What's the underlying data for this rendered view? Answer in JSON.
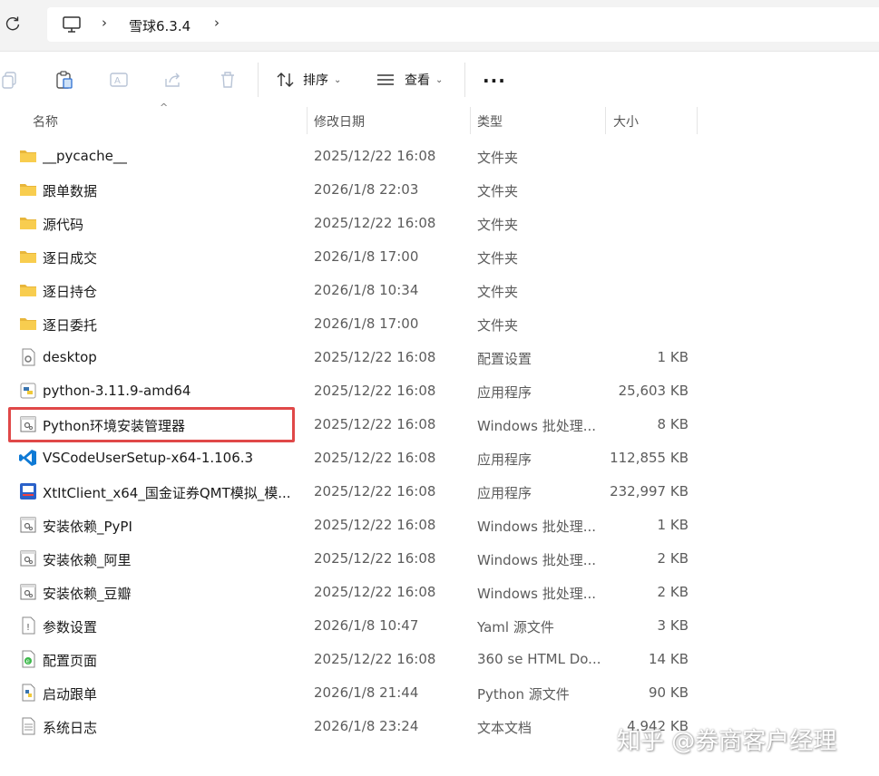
{
  "breadcrumb": {
    "current": "雪球6.3.4"
  },
  "toolbar": {
    "sort_label": "排序",
    "view_label": "查看",
    "more_label": "···"
  },
  "columns": {
    "name": "名称",
    "modified": "修改日期",
    "type": "类型",
    "size": "大小"
  },
  "files": [
    {
      "name": "__pycache__",
      "modified": "2025/12/22 16:08",
      "type": "文件夹",
      "size": "",
      "icon": "folder-icon"
    },
    {
      "name": "跟单数据",
      "modified": "2026/1/8 22:03",
      "type": "文件夹",
      "size": "",
      "icon": "folder-icon"
    },
    {
      "name": "源代码",
      "modified": "2025/12/22 16:08",
      "type": "文件夹",
      "size": "",
      "icon": "folder-icon"
    },
    {
      "name": "逐日成交",
      "modified": "2026/1/8 17:00",
      "type": "文件夹",
      "size": "",
      "icon": "folder-icon"
    },
    {
      "name": "逐日持仓",
      "modified": "2026/1/8 10:34",
      "type": "文件夹",
      "size": "",
      "icon": "folder-icon"
    },
    {
      "name": "逐日委托",
      "modified": "2026/1/8 17:00",
      "type": "文件夹",
      "size": "",
      "icon": "folder-icon"
    },
    {
      "name": "desktop",
      "modified": "2025/12/22 16:08",
      "type": "配置设置",
      "size": "1 KB",
      "icon": "settings-file-icon"
    },
    {
      "name": "python-3.11.9-amd64",
      "modified": "2025/12/22 16:08",
      "type": "应用程序",
      "size": "25,603 KB",
      "icon": "python-installer-icon"
    },
    {
      "name": "Python环境安装管理器",
      "modified": "2025/12/22 16:08",
      "type": "Windows 批处理...",
      "size": "8 KB",
      "icon": "batch-file-icon"
    },
    {
      "name": "VSCodeUserSetup-x64-1.106.3",
      "modified": "2025/12/22 16:08",
      "type": "应用程序",
      "size": "112,855 KB",
      "icon": "vscode-icon"
    },
    {
      "name": "XtItClient_x64_国金证券QMT模拟_模...",
      "modified": "2025/12/22 16:08",
      "type": "应用程序",
      "size": "232,997 KB",
      "icon": "app-installer-icon"
    },
    {
      "name": "安装依赖_PyPI",
      "modified": "2025/12/22 16:08",
      "type": "Windows 批处理...",
      "size": "1 KB",
      "icon": "batch-file-icon"
    },
    {
      "name": "安装依赖_阿里",
      "modified": "2025/12/22 16:08",
      "type": "Windows 批处理...",
      "size": "2 KB",
      "icon": "batch-file-icon"
    },
    {
      "name": "安装依赖_豆瓣",
      "modified": "2025/12/22 16:08",
      "type": "Windows 批处理...",
      "size": "2 KB",
      "icon": "batch-file-icon"
    },
    {
      "name": "参数设置",
      "modified": "2026/1/8 10:47",
      "type": "Yaml 源文件",
      "size": "3 KB",
      "icon": "yaml-file-icon"
    },
    {
      "name": "配置页面",
      "modified": "2025/12/22 16:08",
      "type": "360 se HTML Do...",
      "size": "14 KB",
      "icon": "html-file-icon"
    },
    {
      "name": "启动跟单",
      "modified": "2026/1/8 21:44",
      "type": "Python 源文件",
      "size": "90 KB",
      "icon": "python-file-icon"
    },
    {
      "name": "系统日志",
      "modified": "2026/1/8 23:24",
      "type": "文本文档",
      "size": "4,942 KB",
      "icon": "text-file-icon"
    }
  ],
  "watermark": "知乎 @券商客户经理"
}
